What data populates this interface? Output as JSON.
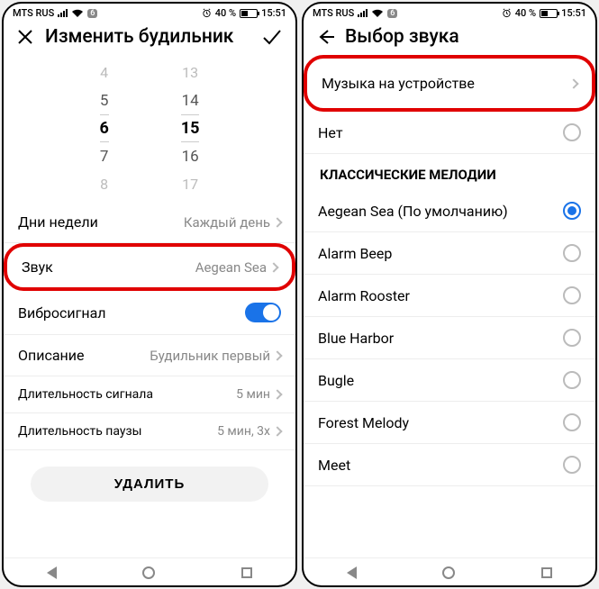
{
  "status": {
    "carrier": "MTS RUS",
    "wifi_badge": "6",
    "battery_pct": "40 %",
    "time": "15:51"
  },
  "left": {
    "title": "Изменить будильник",
    "picker": {
      "hours": [
        "4",
        "5",
        "6",
        "7",
        "8"
      ],
      "minutes": [
        "13",
        "14",
        "15",
        "16",
        "17"
      ]
    },
    "rows": {
      "days": {
        "label": "Дни недели",
        "value": "Каждый день"
      },
      "sound": {
        "label": "Звук",
        "value": "Aegean Sea"
      },
      "vibrate": {
        "label": "Вибросигнал"
      },
      "desc": {
        "label": "Описание",
        "value": "Будильник первый"
      },
      "signal_dur": {
        "label": "Длительность сигнала",
        "value": "5 мин"
      },
      "pause_dur": {
        "label": "Длительность паузы",
        "value": "5 мин, 3x"
      }
    },
    "delete": "УДАЛИТЬ"
  },
  "right": {
    "title": "Выбор звука",
    "music_on_device": "Музыка на устройстве",
    "none": "Нет",
    "section": "КЛАССИЧЕСКИЕ МЕЛОДИИ",
    "melodies": [
      {
        "label": "Aegean Sea (По умолчанию)",
        "selected": true
      },
      {
        "label": "Alarm Beep",
        "selected": false
      },
      {
        "label": "Alarm Rooster",
        "selected": false
      },
      {
        "label": "Blue Harbor",
        "selected": false
      },
      {
        "label": "Bugle",
        "selected": false
      },
      {
        "label": "Forest Melody",
        "selected": false
      },
      {
        "label": "Meet",
        "selected": false
      }
    ]
  }
}
